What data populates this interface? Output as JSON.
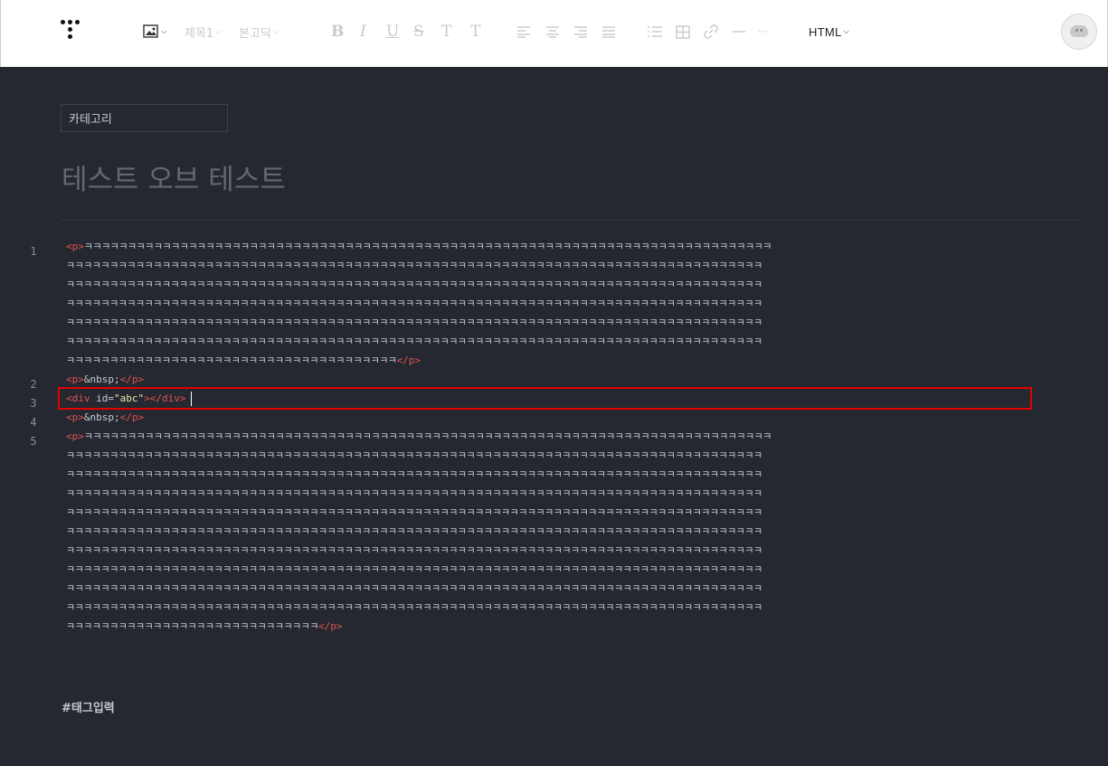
{
  "toolbar": {
    "heading_select": "제목1",
    "font_select": "본고딕",
    "bold": "B",
    "italic": "I",
    "underline": "U",
    "strike": "S",
    "text_color": "T",
    "bg_color": "T",
    "more": "···",
    "mode": "HTML"
  },
  "editor": {
    "category_label": "카테고리",
    "title": "테스트 오브 테스트",
    "tag_placeholder": "#태그입력",
    "line_numbers": [
      "1",
      "2",
      "3",
      "4",
      "5"
    ],
    "line2": {
      "open": "<p>",
      "text": "&nbsp;",
      "close": "</p>"
    },
    "line3": {
      "open_tag": "<div",
      "attr": " id=",
      "value": "\"abc\"",
      "close": "></div>"
    },
    "line4": {
      "open": "<p>",
      "text": "&nbsp;",
      "close": "</p>"
    },
    "p_open": "<p>",
    "p_close": "</p>",
    "filler_char": "ㅋ"
  },
  "colors": {
    "background": "#252830",
    "tag": "#e05252",
    "string": "#f0e3a5",
    "highlight_box": "#e30000"
  }
}
